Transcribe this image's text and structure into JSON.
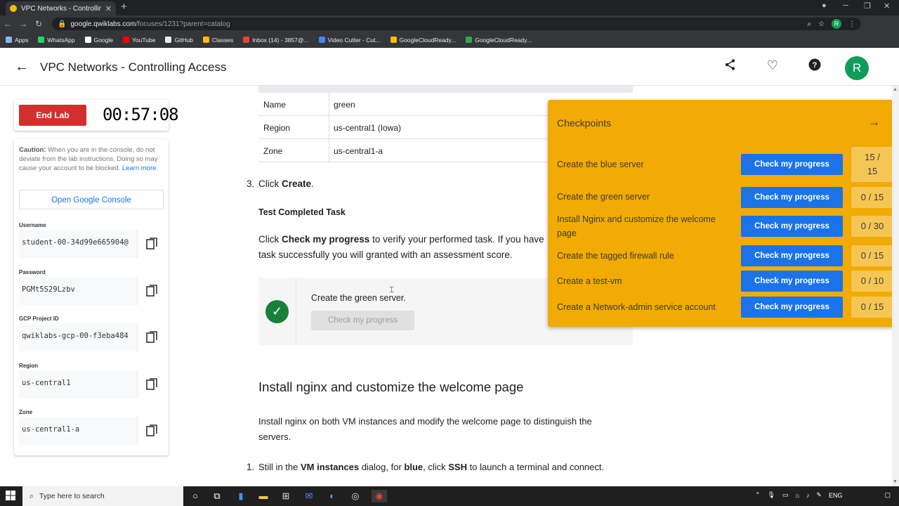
{
  "browser": {
    "tab_title": "VPC Networks - Controlling Acces",
    "new_tab": "+",
    "url_host": "google.qwiklabs.com",
    "url_path": "/focuses/1231?parent=catalog",
    "profile_initial": "R",
    "bookmarks": [
      {
        "label": "Apps",
        "color": "#8ab4f8"
      },
      {
        "label": "WhatsApp",
        "color": "#25d366"
      },
      {
        "label": "Google",
        "color": "#ffffff"
      },
      {
        "label": "YouTube",
        "color": "#ff0000"
      },
      {
        "label": "GitHub",
        "color": "#e8eaed"
      },
      {
        "label": "Classes",
        "color": "#fbbc04"
      },
      {
        "label": "Inbox (14) - 3857@...",
        "color": "#ea4335"
      },
      {
        "label": "Video Cutter - Cut...",
        "color": "#4285f4"
      },
      {
        "label": "GoogleCloudReady...",
        "color": "#fbbc04"
      },
      {
        "label": "GoogleCloudReady...",
        "color": "#34a853"
      }
    ]
  },
  "header": {
    "title": "VPC Networks - Controlling Access",
    "avatar_initial": "R"
  },
  "sidebar": {
    "end_lab_label": "End Lab",
    "timer": "00:57:08",
    "caution_bold": "Caution:",
    "caution_text": " When you are in the console, do not deviate from the lab instructions. Doing so may cause your account to be blocked.",
    "learn_more": "Learn more.",
    "open_console_label": "Open Google Console",
    "fields": [
      {
        "label": "Username",
        "value": "student-00-34d99e665904@"
      },
      {
        "label": "Password",
        "value": "PGMt5S29Lzbv"
      },
      {
        "label": "GCP Project ID",
        "value": "qwiklabs-gcp-00-f3eba484"
      },
      {
        "label": "Region",
        "value": "us-central1"
      },
      {
        "label": "Zone",
        "value": "us-central1-a"
      }
    ]
  },
  "content": {
    "table_rows": [
      {
        "key": "Name",
        "value": "green"
      },
      {
        "key": "Region",
        "value": "us-central1 (Iowa)"
      },
      {
        "key": "Zone",
        "value": "us-central1-a"
      }
    ],
    "step3_num": "3.",
    "step3_pre": "Click ",
    "step3_bold": "Create",
    "step3_post": ".",
    "test_heading": "Test Completed Task",
    "test_para_pre": "Click ",
    "test_para_bold": "Check my progress",
    "test_para_line1_post": " to verify your performed task. If you have",
    "test_para_line2": "task successfully you will granted with an assessment score.",
    "task_title": "Create the green server.",
    "task_button": "Check my progress",
    "section_heading": "Install nginx and customize the welcome page",
    "section_line1": "Install nginx on both VM instances and modify the welcome page to distinguish the",
    "section_line2": "servers.",
    "step1_num": "1.",
    "step1_a": "Still in the ",
    "step1_b": "VM instances",
    "step1_c": " dialog, for ",
    "step1_d": "blue",
    "step1_e": ", click ",
    "step1_f": "SSH",
    "step1_g": " to launch a terminal and connect."
  },
  "checkpoints": {
    "title": "Checkpoints",
    "items": [
      {
        "name": "Create the blue server",
        "button": "Check my progress",
        "score_a": "15 /",
        "score_b": "15"
      },
      {
        "name": "Create the green server",
        "button": "Check my progress",
        "score_a": "0 / 15",
        "score_b": ""
      },
      {
        "name": "Install Nginx and customize the welcome page",
        "button": "Check my progress",
        "score_a": "0 / 30",
        "score_b": ""
      },
      {
        "name": "Create the tagged firewall rule",
        "button": "Check my progress",
        "score_a": "0 / 15",
        "score_b": ""
      },
      {
        "name": "Create a test-vm",
        "button": "Check my progress",
        "score_a": "0 / 10",
        "score_b": ""
      },
      {
        "name": "Create a Network-admin service account",
        "button": "Check my progress",
        "score_a": "0 / 15",
        "score_b": ""
      }
    ]
  },
  "taskbar": {
    "search_placeholder": "Type here to search",
    "lang": "ENG"
  },
  "colors": {
    "checkpoint_panel": "#f2aa04",
    "primary_button": "#1a73e8",
    "end_lab": "#d32f2f",
    "success": "#188038"
  }
}
